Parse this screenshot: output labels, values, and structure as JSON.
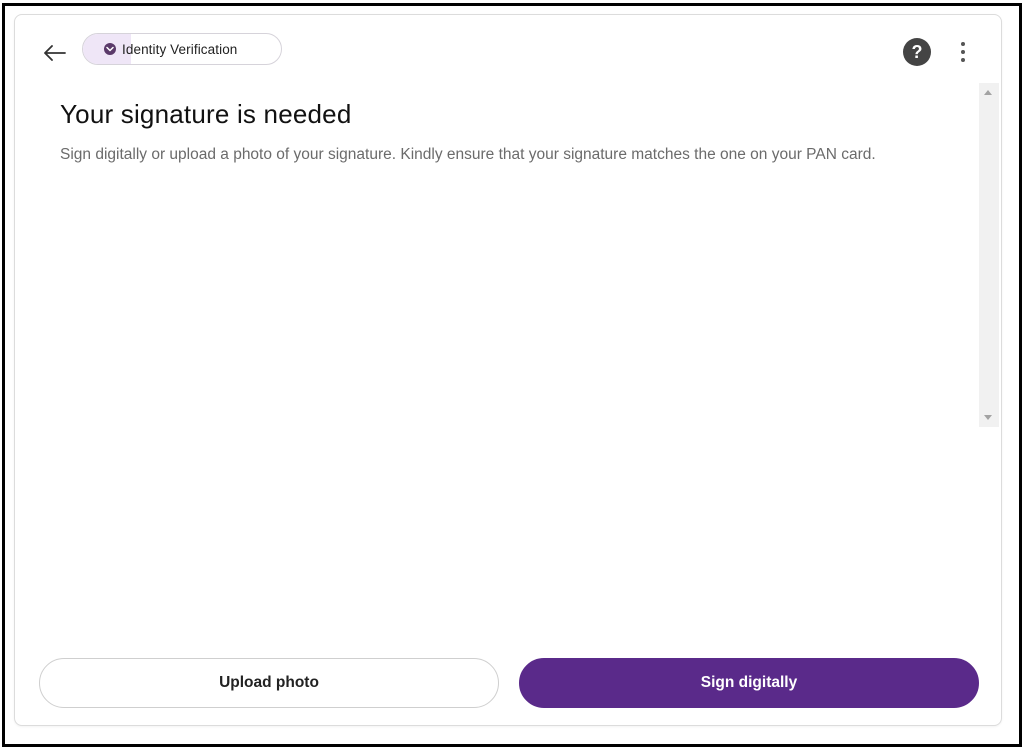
{
  "header": {
    "back_icon": "arrow-left-icon",
    "chip_label": "Identity Verification",
    "chip_icon": "chevron-down-circle-icon",
    "help_label": "?",
    "help_icon": "help-circle-icon",
    "more_icon": "more-vertical-icon"
  },
  "main": {
    "title": "Your signature is needed",
    "description": "Sign digitally or upload a photo of your signature. Kindly ensure that your signature matches the one on your PAN card."
  },
  "footer": {
    "upload_label": "Upload photo",
    "sign_label": "Sign digitally"
  },
  "colors": {
    "primary": "#5a2a8a",
    "chip_accent": "#efe6f7",
    "text_primary": "#111111",
    "text_secondary": "#6b6b6b"
  }
}
